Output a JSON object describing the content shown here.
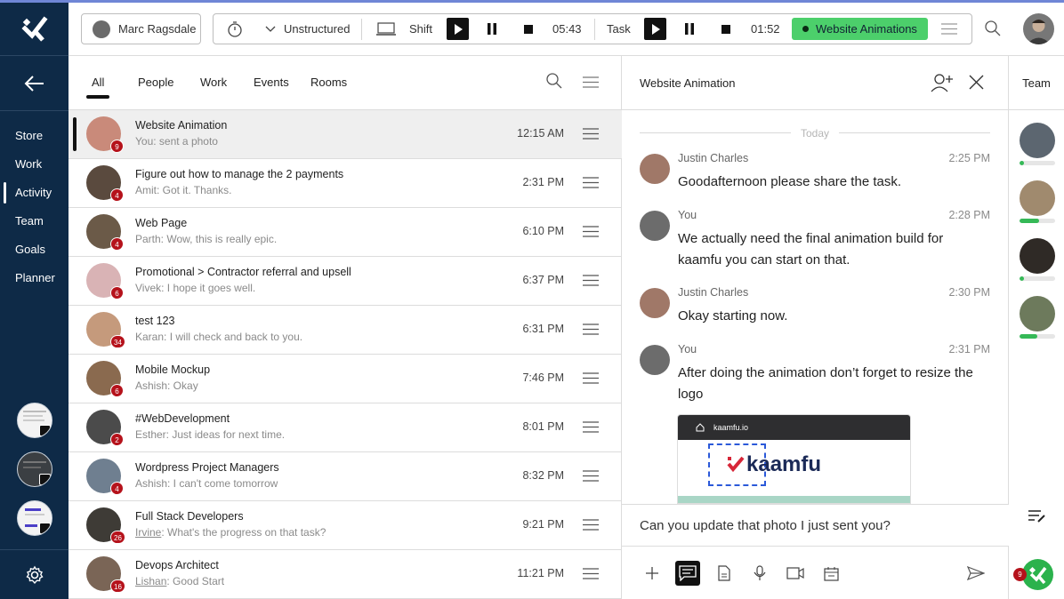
{
  "colors": {
    "sidebar": "#0e2a47",
    "accent_green": "#4ccf6b",
    "badge_red": "#b5121b",
    "selected_row": "#efefef"
  },
  "sidebar": {
    "logo_icon": "kaamfu-logo-icon",
    "back_icon": "arrow-left-icon",
    "items": [
      {
        "label": "Store",
        "active": false
      },
      {
        "label": "Work",
        "active": false
      },
      {
        "label": "Activity",
        "active": true
      },
      {
        "label": "Team",
        "active": false
      },
      {
        "label": "Goals",
        "active": false
      },
      {
        "label": "Planner",
        "active": false
      }
    ],
    "settings_icon": "gear-icon"
  },
  "topbar": {
    "user_name": "Marc Ragsdale",
    "mode": "Unstructured",
    "shift_label": "Shift",
    "shift_time": "05:43",
    "task_label": "Task",
    "task_time": "01:52",
    "current_task": "Website Animations"
  },
  "list": {
    "tabs": [
      "All",
      "People",
      "Work",
      "Events",
      "Rooms"
    ],
    "active_tab": "All",
    "rows": [
      {
        "title": "Website Animation",
        "preview_author": "",
        "preview": "You: sent a photo",
        "time": "12:15 AM",
        "badge": "9",
        "avatar": "#c98a7a"
      },
      {
        "title": "Figure out how to manage the 2 payments",
        "preview_author": "",
        "preview": "Amit: Got it. Thanks.",
        "time": "2:31 PM",
        "badge": "4",
        "avatar": "#5a4a3e"
      },
      {
        "title": "Web Page",
        "preview_author": "",
        "preview": "Parth: Wow, this is really epic.",
        "time": "6:10 PM",
        "badge": "4",
        "avatar": "#6b5a48"
      },
      {
        "title": "Promotional > Contractor referral and upsell",
        "preview_author": "",
        "preview": "Vivek: I hope it goes well.",
        "time": "6:37 PM",
        "badge": "6",
        "avatar": "#d9b3b5"
      },
      {
        "title": "test 123",
        "preview_author": "",
        "preview": "Karan: I will check and back to you.",
        "time": "6:31 PM",
        "badge": "34",
        "avatar": "#c59a7c"
      },
      {
        "title": "Mobile Mockup",
        "preview_author": "",
        "preview": "Ashish: Okay",
        "time": "7:46 PM",
        "badge": "6",
        "avatar": "#8a6a4f"
      },
      {
        "title": "#WebDevelopment",
        "preview_author": "",
        "preview": "Esther: Just ideas for next time.",
        "time": "8:01 PM",
        "badge": "2",
        "avatar": "#4b4b4b"
      },
      {
        "title": "Wordpress Project Managers",
        "preview_author": "",
        "preview": "Ashish: I can't come tomorrow",
        "time": "8:32 PM",
        "badge": "4",
        "avatar": "#6f7f90"
      },
      {
        "title": "Full Stack Developers",
        "preview_author": "Irvine",
        "preview": ": What's the progress on that  task?",
        "time": "9:21 PM",
        "badge": "26",
        "avatar": "#3e3b36"
      },
      {
        "title": "Devops Architect",
        "preview_author": "Lishan",
        "preview": ": Good Start",
        "time": "11:21 PM",
        "badge": "16",
        "avatar": "#7a6556"
      }
    ]
  },
  "chat": {
    "title": "Website Animation",
    "date_divider": "Today",
    "messages": [
      {
        "sender": "Justin Charles",
        "time": "2:25 PM",
        "text": "Goodafternoon please share the task.",
        "avatar": "#a07868"
      },
      {
        "sender": "You",
        "time": "2:28 PM",
        "text": "We actually need the final animation build for kaamfu you can start on that.",
        "avatar": "#6c6c6c"
      },
      {
        "sender": "Justin Charles",
        "time": "2:30 PM",
        "text": "Okay starting now.",
        "avatar": "#a07868"
      },
      {
        "sender": "You",
        "time": "2:31 PM",
        "text": "After doing the animation don’t forget to resize the logo",
        "avatar": "#6c6c6c"
      }
    ],
    "attachment": {
      "url_text": "kaamfu.io",
      "brand_text": "kaamfu"
    },
    "composer_text": "Can you update that photo I just sent you?"
  },
  "team": {
    "title": "Team",
    "members": [
      {
        "progress": 0.12,
        "avatar": "#5c6670"
      },
      {
        "progress": 0.55,
        "avatar": "#a08a6e"
      },
      {
        "progress": 0.12,
        "avatar": "#2f2a26"
      },
      {
        "progress": 0.5,
        "avatar": "#6d7a5c"
      }
    ],
    "notification_count": "9"
  }
}
